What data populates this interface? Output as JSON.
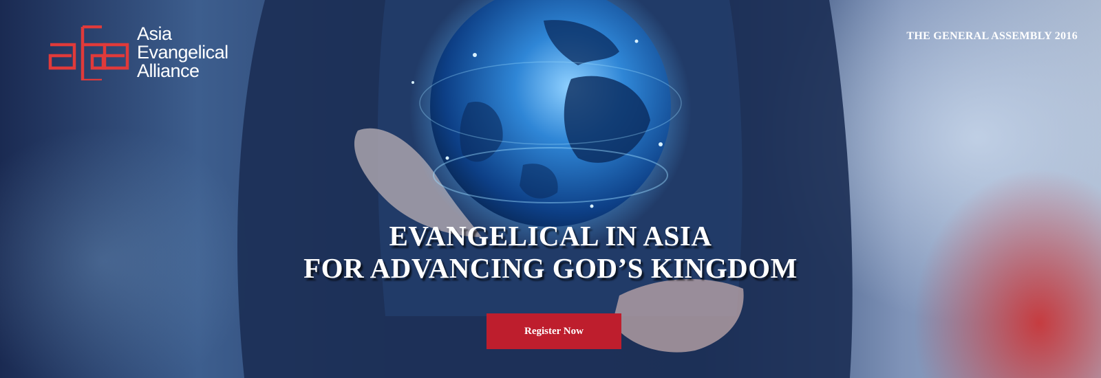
{
  "banner": {
    "logo": {
      "mark": "aea",
      "name_lines": [
        "Asia",
        "Evangelical",
        "Alliance"
      ],
      "color": "#e03a3a"
    },
    "event_label": "THE GENERAL ASSEMBLY 2016",
    "headline": {
      "line1": "EVANGELICAL IN ASIA",
      "line2": "FOR ADVANCING GOD’S KINGDOM"
    },
    "register_button": {
      "label": "Register Now",
      "color": "#be1e2d"
    },
    "background_image": {
      "subject": "hands-holding-glowing-globe"
    }
  }
}
